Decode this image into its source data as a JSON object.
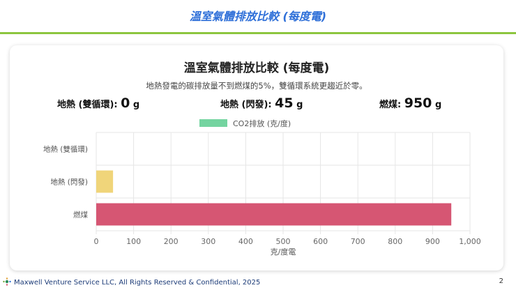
{
  "slide": {
    "header_title": "溫室氣體排放比較 (每度電)",
    "footer": "Maxwell Venture Service LLC, All Rights Reserved & Confidential, 2025",
    "page_number": "2",
    "accent_rule": "#8cc63f"
  },
  "card": {
    "title": "溫室氣體排放比較 (每度電)",
    "subtitle": "地熱發電的碳排放量不到燃煤的5%，雙循環系統更趨近於零。",
    "stats": [
      {
        "label": "地熱 (雙循環):",
        "value": "0",
        "unit": "g"
      },
      {
        "label": "地熱 (閃發):",
        "value": "45",
        "unit": "g"
      },
      {
        "label": "燃煤:",
        "value": "950",
        "unit": "g"
      }
    ]
  },
  "chart_data": {
    "type": "bar",
    "orientation": "horizontal",
    "categories": [
      "地熱 (雙循環)",
      "地熱 (閃發)",
      "燃煤"
    ],
    "series": [
      {
        "name": "CO2排放 (克/度)",
        "values": [
          0,
          45,
          950
        ],
        "colors": [
          "#74d4a0",
          "#f0d57a",
          "#d65673"
        ]
      }
    ],
    "xlabel": "克/度電",
    "xlim": [
      0,
      1000
    ],
    "xticks": [
      "0",
      "100",
      "200",
      "300",
      "400",
      "500",
      "600",
      "700",
      "800",
      "900",
      "1,000"
    ],
    "grid": true,
    "legend_position": "top-center",
    "legend_color": "#74d4a0"
  }
}
